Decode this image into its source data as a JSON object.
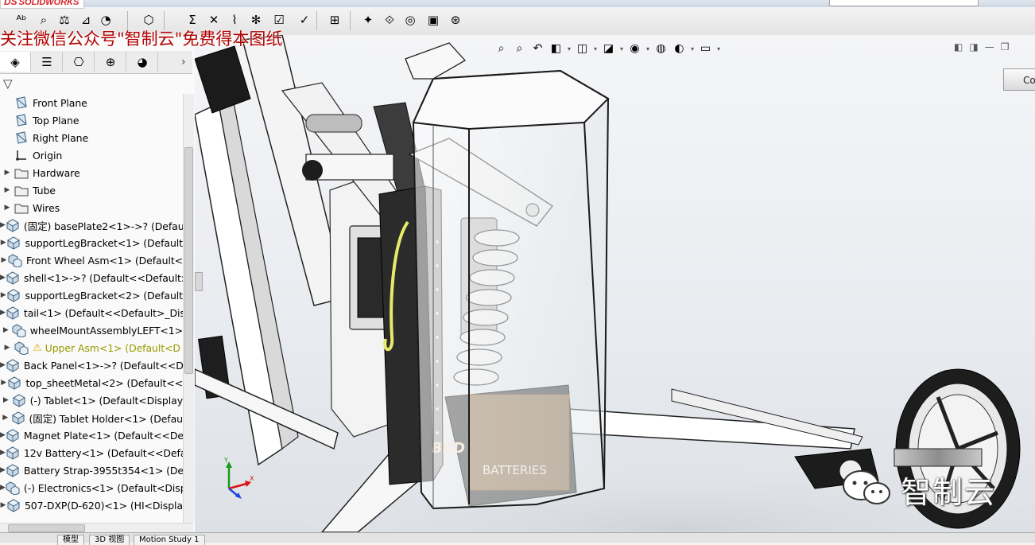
{
  "app": {
    "brand_mark": "DS",
    "brand_name": "SOLIDWORKS",
    "watermark": "关注微信公众号\"智制云\"免费得本图纸"
  },
  "toolbar": {
    "buttons": [
      {
        "icon": "spelling-icon",
        "glyph": "ᴬᵇ"
      },
      {
        "icon": "measure-icon",
        "glyph": "⌕"
      },
      {
        "icon": "mass-properties-icon",
        "glyph": "⚖"
      },
      {
        "icon": "section-properties-icon",
        "glyph": "⊿"
      },
      {
        "icon": "sensor-icon",
        "glyph": "◔"
      },
      {
        "icon": "assembly-visualization-icon",
        "glyph": "⬡"
      },
      {
        "icon": "sum-icon",
        "glyph": "Σ"
      },
      {
        "icon": "interference-icon",
        "glyph": "✕"
      },
      {
        "icon": "clearance-icon",
        "glyph": "⌇"
      },
      {
        "icon": "hole-alignment-icon",
        "glyph": "✻"
      },
      {
        "icon": "check-icon",
        "glyph": "☑"
      },
      {
        "icon": "symmetry-icon",
        "glyph": "✓"
      },
      {
        "icon": "export-icon",
        "glyph": "⊞"
      },
      {
        "icon": "motion-icon",
        "glyph": "✦"
      },
      {
        "icon": "simulation-icon",
        "glyph": "⟐"
      },
      {
        "icon": "costing-icon",
        "glyph": "◎"
      },
      {
        "icon": "design-checker-icon",
        "glyph": "▣"
      },
      {
        "icon": "global-icon",
        "glyph": "⊛"
      }
    ]
  },
  "panel": {
    "tabs": [
      {
        "name": "feature-manager-tab",
        "glyph": "◈"
      },
      {
        "name": "property-manager-tab",
        "glyph": "☰"
      },
      {
        "name": "configuration-manager-tab",
        "glyph": "⎔"
      },
      {
        "name": "dimxpert-tab",
        "glyph": "⊕"
      },
      {
        "name": "display-manager-tab",
        "glyph": "◕"
      }
    ],
    "expand_glyph": "›",
    "filter_glyph": "▽",
    "tree": [
      {
        "label": "Front Plane",
        "icon": "plane-icon",
        "expander": false
      },
      {
        "label": "Top Plane",
        "icon": "plane-icon",
        "expander": false
      },
      {
        "label": "Right Plane",
        "icon": "plane-icon",
        "expander": false
      },
      {
        "label": "Origin",
        "icon": "origin-icon",
        "expander": false
      },
      {
        "label": "Hardware",
        "icon": "folder-icon",
        "expander": true
      },
      {
        "label": "Tube",
        "icon": "folder-icon",
        "expander": true
      },
      {
        "label": "Wires",
        "icon": "folder-icon",
        "expander": true
      },
      {
        "label": "(固定) basePlate2<1>->? (Default",
        "icon": "part-icon",
        "expander": true
      },
      {
        "label": "supportLegBracket<1> (Default",
        "icon": "part-icon",
        "expander": true
      },
      {
        "label": "Front Wheel Asm<1> (Default<",
        "icon": "assembly-icon",
        "expander": true
      },
      {
        "label": "shell<1>->? (Default<<Default:",
        "icon": "part-icon",
        "expander": true
      },
      {
        "label": "supportLegBracket<2> (Default",
        "icon": "part-icon",
        "expander": true
      },
      {
        "label": "tail<1> (Default<<Default>_Dis",
        "icon": "part-icon",
        "expander": true
      },
      {
        "label": "wheelMountAssemblyLEFT<1>",
        "icon": "assembly-icon",
        "expander": true
      },
      {
        "label": "Upper Asm<1> (Default<D",
        "icon": "assembly-icon",
        "expander": true,
        "warning": true
      },
      {
        "label": "Back Panel<1>->? (Default<<D",
        "icon": "part-icon",
        "expander": true
      },
      {
        "label": "top_sheetMetal<2> (Default<<",
        "icon": "part-icon",
        "expander": true
      },
      {
        "label": "(-) Tablet<1> (Default<Display",
        "icon": "part-icon",
        "expander": true
      },
      {
        "label": "(固定) Tablet Holder<1> (Defau",
        "icon": "part-icon",
        "expander": true
      },
      {
        "label": "Magnet Plate<1> (Default<<De",
        "icon": "part-icon",
        "expander": true
      },
      {
        "label": "12v Battery<1> (Default<<Defa",
        "icon": "part-icon",
        "expander": true
      },
      {
        "label": "Battery Strap-3955t354<1> (De",
        "icon": "part-icon",
        "expander": true
      },
      {
        "label": "(-) Electronics<1> (Default<Disp",
        "icon": "assembly-icon",
        "expander": true
      },
      {
        "label": "507-DXP(D-620)<1> (HI<Displa",
        "icon": "part-icon",
        "expander": true
      }
    ]
  },
  "viewport": {
    "heads_up": [
      {
        "icon": "zoom-to-fit-icon",
        "glyph": "⌕"
      },
      {
        "icon": "zoom-to-area-icon",
        "glyph": "⌕"
      },
      {
        "icon": "previous-view-icon",
        "glyph": "↶"
      },
      {
        "icon": "section-view-icon",
        "glyph": "◧"
      },
      {
        "icon": "view-orientation-icon",
        "glyph": "◫"
      },
      {
        "icon": "display-style-icon",
        "glyph": "◪"
      },
      {
        "icon": "hide-show-items-icon",
        "glyph": "◉"
      },
      {
        "icon": "edit-appearance-icon",
        "glyph": "◍"
      },
      {
        "icon": "apply-scene-icon",
        "glyph": "◐"
      },
      {
        "icon": "view-settings-icon",
        "glyph": "▭"
      }
    ],
    "window_controls": [
      "◧",
      "◨",
      "—",
      "❐"
    ],
    "corner_button": "Co",
    "triad_axes": [
      "Y",
      "X"
    ],
    "logo_text": "智制云"
  },
  "bottom_tabs": [
    "模型",
    "3D 视图",
    "Motion Study 1"
  ],
  "colors": {
    "accent": "#d8232a",
    "watermark": "#b00000",
    "warning": "#9a9a00"
  }
}
